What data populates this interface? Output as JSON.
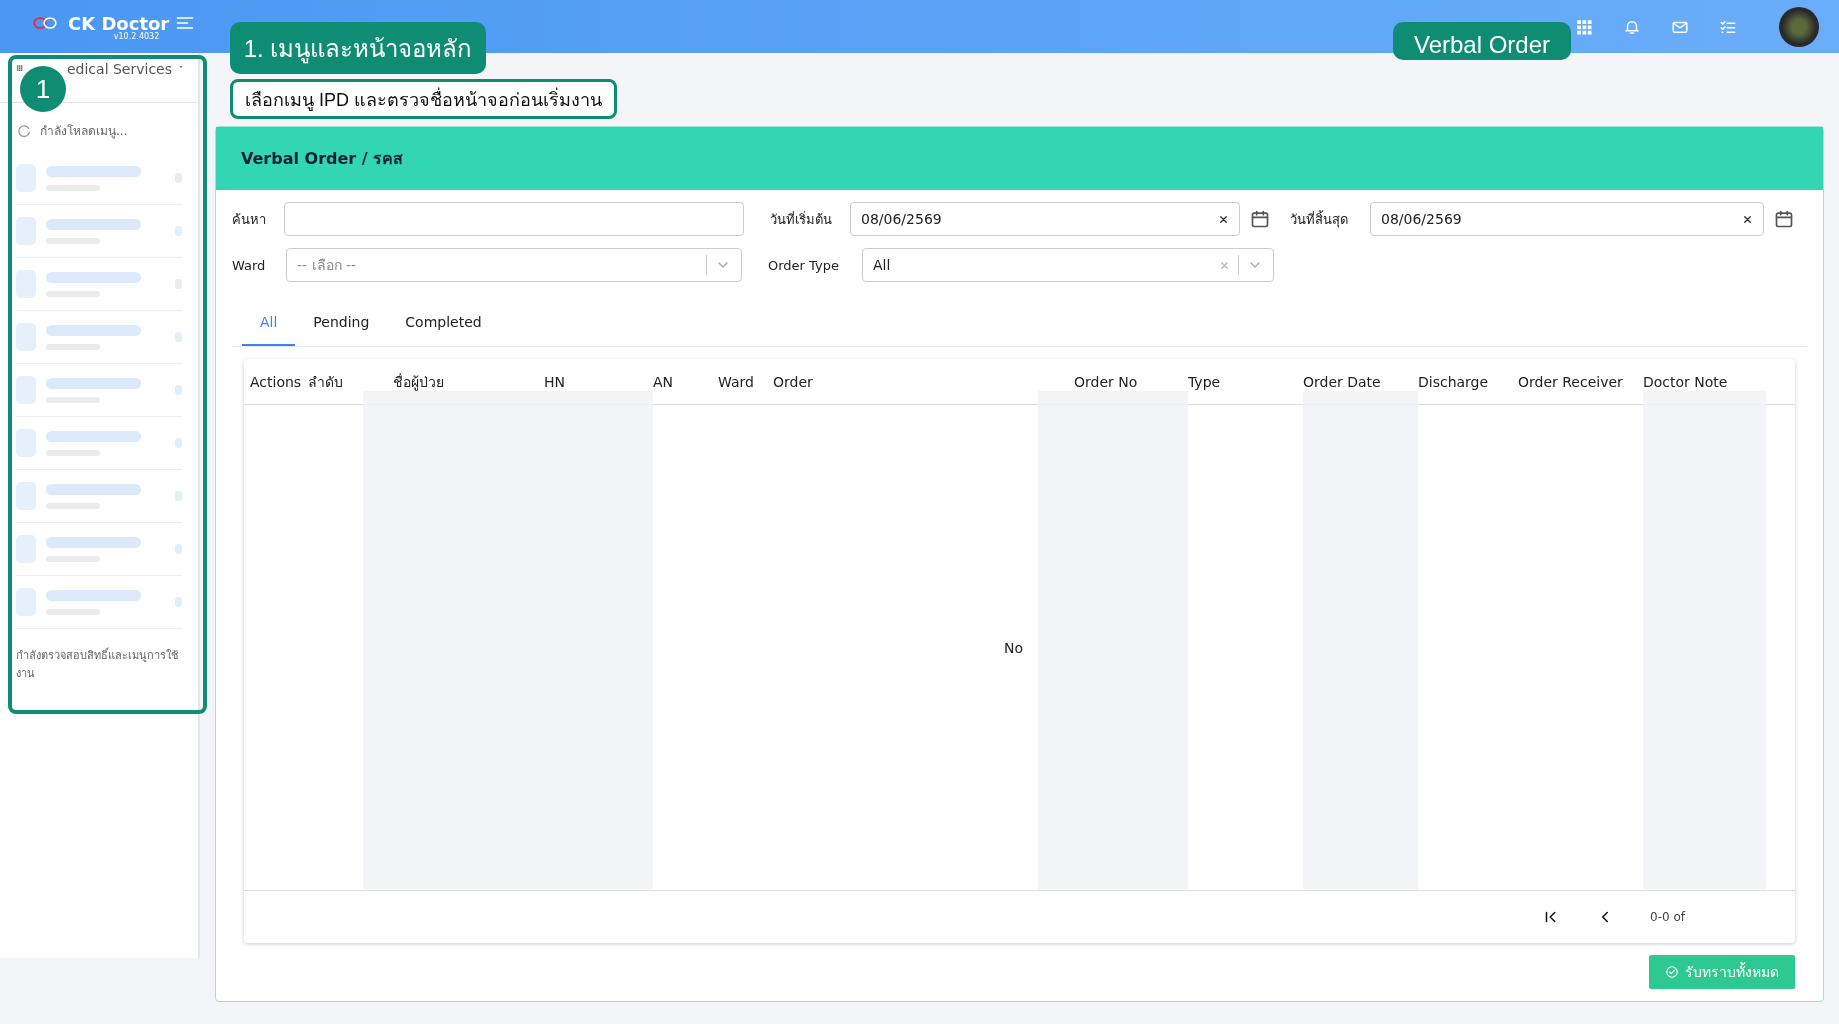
{
  "header": {
    "brand": "CK Doctor",
    "version": "v10.2.4032"
  },
  "callouts": {
    "section_title": "1. เมนูและหน้าจอหลัก",
    "instruction": "เลือกเมนู IPD และตรวจชื่อหน้าจอก่อนเริ่มงาน",
    "screen_name": "Verbal Order",
    "badge": "1"
  },
  "sidebar": {
    "module": "edical Services",
    "loading_text": "กำลังโหลดเมนู...",
    "footer_text": "กำลังตรวจสอบสิทธิ์และเมนูการใช้งาน"
  },
  "card": {
    "title": "Verbal Order / รคส"
  },
  "filters": {
    "search_label": "ค้นหา",
    "start_label": "วันที่เริ่มต้น",
    "start_value": "08/06/2569",
    "end_label": "วันที่สิ้นสุด",
    "end_value": "08/06/2569",
    "ward_label": "Ward",
    "ward_placeholder": "-- เลือก --",
    "type_label": "Order Type",
    "type_value": "All"
  },
  "tabs": [
    {
      "label": "All",
      "selected": true
    },
    {
      "label": "Pending",
      "selected": false
    },
    {
      "label": "Completed",
      "selected": false
    }
  ],
  "table": {
    "columns": [
      "Actions",
      "ลำดับ",
      "ชื่อผู้ป่วย",
      "HN",
      "AN",
      "Ward",
      "Order",
      "Order No",
      "Type",
      "Order Date",
      "Discharge",
      "Order Receiver",
      "Doctor Note"
    ],
    "empty_text": "No",
    "pagination": "0-0 of"
  },
  "acknowledge_button": "รับทราบทั้งหมด"
}
